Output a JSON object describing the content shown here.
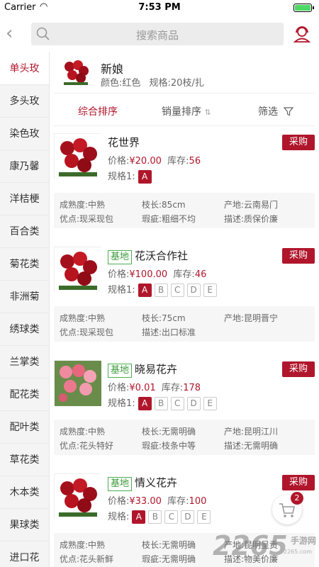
{
  "status_bar": {
    "carrier": "Carrier",
    "time": "7:53 PM"
  },
  "search": {
    "placeholder": "搜索商品"
  },
  "sidebar": {
    "items": [
      {
        "label": "单头玫",
        "active": true
      },
      {
        "label": "多头玫"
      },
      {
        "label": "染色玫"
      },
      {
        "label": "康乃馨"
      },
      {
        "label": "洋桔梗"
      },
      {
        "label": "百合类"
      },
      {
        "label": "菊花类"
      },
      {
        "label": "非洲菊"
      },
      {
        "label": "绣球类"
      },
      {
        "label": "兰掌类"
      },
      {
        "label": "配花类"
      },
      {
        "label": "配叶类"
      },
      {
        "label": "草花类"
      },
      {
        "label": "木本类"
      },
      {
        "label": "果球类"
      },
      {
        "label": "进口花"
      }
    ]
  },
  "category": {
    "name": "新娘",
    "color": "颜色:红色",
    "spec": "规格:20枝/扎"
  },
  "sort": {
    "comprehensive": "综合排序",
    "sales": "销量排序",
    "filter": "筛选"
  },
  "labels": {
    "price": "价格:",
    "stock": "库存:",
    "buy": "采购",
    "base_tag": "基地",
    "currency": "¥"
  },
  "products": [
    {
      "name": "花世界",
      "base": false,
      "price": "¥20.00",
      "stock": "56",
      "spec_label": "规格1:",
      "specs": [
        "A"
      ],
      "maturity": "成熟度:中熟",
      "length": "枝长:85cm",
      "origin": "产地:云南易门",
      "merit": "优点:现采现包",
      "flaw": "瑕疵:粗细不均",
      "desc": "描述:质保价廉"
    },
    {
      "name": "花沃合作社",
      "base": true,
      "price": "¥100.00",
      "stock": "46",
      "spec_label": "规格1:",
      "specs": [
        "A",
        "B",
        "C",
        "D",
        "E"
      ],
      "maturity": "成熟度:中熟",
      "length": "枝长:75cm",
      "origin": "产地:昆明晋宁",
      "merit": "优点:现采现包",
      "flaw": "",
      "desc": "描述:出口标准"
    },
    {
      "name": "晓易花卉",
      "base": true,
      "price": "¥0.01",
      "stock": "178",
      "spec_label": "规格1:",
      "specs": [
        "A",
        "B",
        "C",
        "D",
        "E"
      ],
      "maturity": "成熟度:中熟",
      "length": "枝长:无需明确",
      "origin": "产地:昆明江川",
      "merit": "优点:花头特好",
      "flaw": "瑕疵:枝条中等",
      "desc": "描述:无需明确"
    },
    {
      "name": "情义花卉",
      "base": true,
      "price": "¥33.00",
      "stock": "100",
      "spec_label": "规格:",
      "specs": [
        "A",
        "B",
        "C",
        "D",
        "E"
      ],
      "maturity": "成熟度:中熟",
      "length": "枝长:无需明确",
      "origin": "产地:昆明呈贡",
      "merit": "优点:花头新鲜",
      "flaw": "瑕疵:无需明确",
      "desc": "描述:物美价廉"
    }
  ],
  "cart": {
    "count": "2"
  },
  "watermark": {
    "brand": "2265",
    "site": "手游网",
    "url": "2265.com"
  },
  "colors": {
    "accent": "#b0162b",
    "base_tag": "#3b9b3b"
  }
}
